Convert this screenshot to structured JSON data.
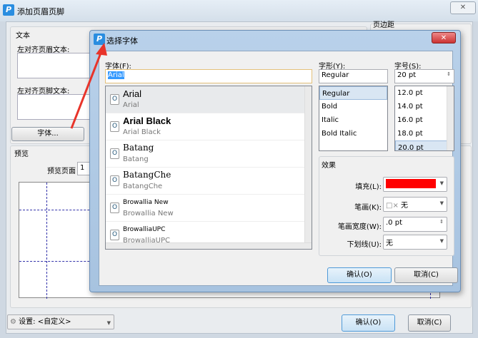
{
  "window": {
    "title": "添加页眉页脚",
    "close": "✕"
  },
  "text_group": {
    "title": "文本",
    "header_left_label": "左对齐页眉文本:",
    "footer_left_label": "左对齐页脚文本:",
    "font_button": "字体..."
  },
  "margin_group": {
    "title": "页边距"
  },
  "preview": {
    "title": "预览",
    "page_label": "预览页面",
    "page_value": "1"
  },
  "bottom": {
    "settings_label": "设置:",
    "settings_value": "<自定义>",
    "ok": "确认(O)",
    "cancel": "取消(C)"
  },
  "font_dialog": {
    "title": "选择字体",
    "close": "✕",
    "font_label": "字体(F):",
    "font_value": "Arial",
    "fonts": [
      {
        "name": "Arial",
        "sample": "Arial"
      },
      {
        "name": "Arial Black",
        "sample": "Arial Black"
      },
      {
        "name": "Batang",
        "sample": "Batang"
      },
      {
        "name": "BatangChe",
        "sample": "BatangChe"
      },
      {
        "name": "Browallia New",
        "sample": "Browallia New"
      },
      {
        "name": "BrowalliaUPC",
        "sample": "BrowalliaUPC"
      }
    ],
    "style_label": "字形(Y):",
    "style_value": "Regular",
    "styles": [
      "Regular",
      "Bold",
      "Italic",
      "Bold Italic"
    ],
    "size_label": "字号(S):",
    "size_value": "20 pt",
    "sizes": [
      "12.0 pt",
      "14.0 pt",
      "16.0 pt",
      "18.0 pt",
      "20.0 pt"
    ],
    "effects": {
      "title": "效果",
      "fill_label": "填充(L):",
      "fill_color": "#ff0000",
      "stroke_label": "笔画(K):",
      "stroke_value": "无",
      "stroke_width_label": "笔画宽度(W):",
      "stroke_width_value": ".0 pt",
      "underline_label": "下划线(U):",
      "underline_value": "无"
    },
    "ok": "确认(O)",
    "cancel": "取消(C)"
  },
  "annotation_color": "#e8342a"
}
